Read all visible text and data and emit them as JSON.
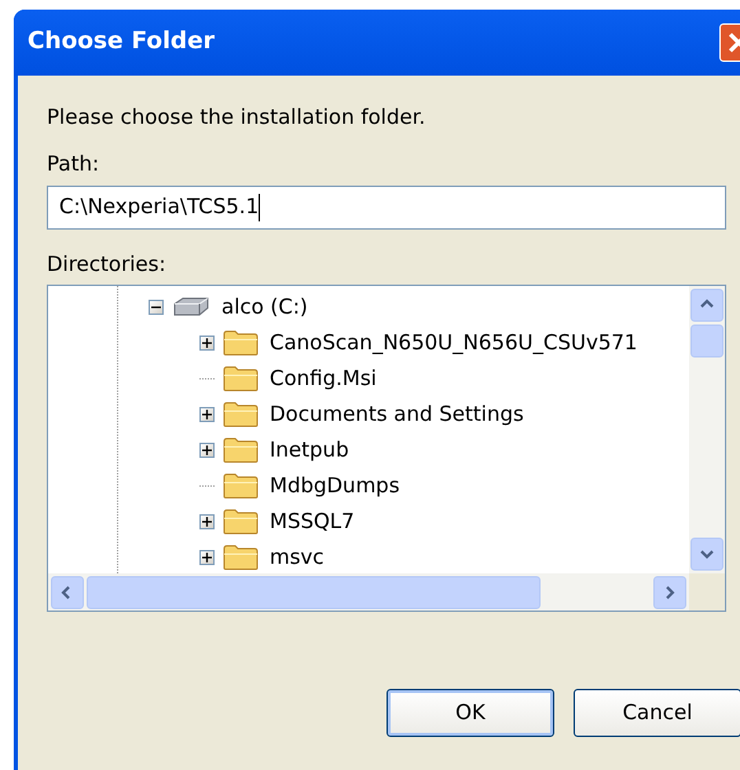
{
  "window": {
    "title": "Choose Folder"
  },
  "prompt": "Please choose the installation folder.",
  "path": {
    "label": "Path:",
    "value": "C:\\Nexperia\\TCS5.1"
  },
  "directories": {
    "label": "Directories:",
    "tree": [
      {
        "label": "alco (C:)",
        "kind": "drive",
        "expanded": true,
        "children": [
          {
            "label": "CanoScan_N650U_N656U_CSUv571",
            "kind": "folder",
            "has_children": true,
            "expanded": false
          },
          {
            "label": "Config.Msi",
            "kind": "folder",
            "has_children": false
          },
          {
            "label": "Documents and Settings",
            "kind": "folder",
            "has_children": true,
            "expanded": false
          },
          {
            "label": "Inetpub",
            "kind": "folder",
            "has_children": true,
            "expanded": false
          },
          {
            "label": "MdbgDumps",
            "kind": "folder",
            "has_children": false
          },
          {
            "label": "MSSQL7",
            "kind": "folder",
            "has_children": true,
            "expanded": false
          },
          {
            "label": "msvc",
            "kind": "folder",
            "has_children": true,
            "expanded": false
          }
        ]
      }
    ]
  },
  "buttons": [
    {
      "label": "OK",
      "default": true
    },
    {
      "label": "Cancel",
      "default": false
    }
  ]
}
